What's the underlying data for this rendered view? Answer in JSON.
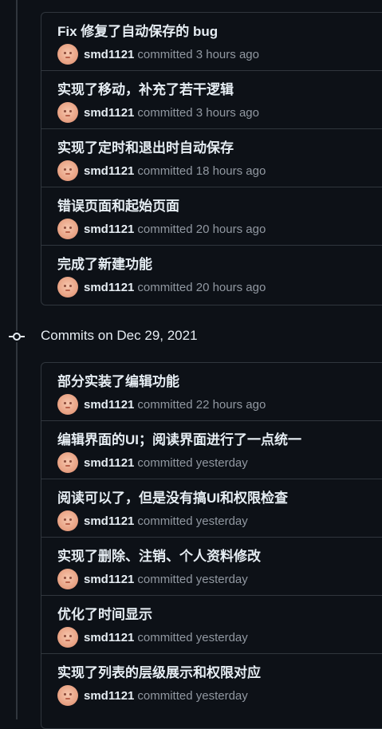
{
  "groups": [
    {
      "header": "",
      "commits": [
        {
          "title": "Fix 修复了自动保存的 bug",
          "author": "smd1121",
          "meta": "committed 3 hours ago"
        },
        {
          "title": "实现了移动，补充了若干逻辑",
          "author": "smd1121",
          "meta": "committed 3 hours ago"
        },
        {
          "title": "实现了定时和退出时自动保存",
          "author": "smd1121",
          "meta": "committed 18 hours ago"
        },
        {
          "title": "错误页面和起始页面",
          "author": "smd1121",
          "meta": "committed 20 hours ago"
        },
        {
          "title": "完成了新建功能",
          "author": "smd1121",
          "meta": "committed 20 hours ago"
        }
      ]
    },
    {
      "header": "Commits on Dec 29, 2021",
      "commits": [
        {
          "title": "部分实装了编辑功能",
          "author": "smd1121",
          "meta": "committed 22 hours ago"
        },
        {
          "title": "编辑界面的UI；阅读界面进行了一点统一",
          "author": "smd1121",
          "meta": "committed yesterday"
        },
        {
          "title": "阅读可以了，但是没有搞UI和权限检查",
          "author": "smd1121",
          "meta": "committed yesterday"
        },
        {
          "title": "实现了删除、注销、个人资料修改",
          "author": "smd1121",
          "meta": "committed yesterday"
        },
        {
          "title": "优化了时间显示",
          "author": "smd1121",
          "meta": "committed yesterday"
        },
        {
          "title": "实现了列表的层级展示和权限对应",
          "author": "smd1121",
          "meta": "committed yesterday"
        }
      ]
    }
  ],
  "icons": {
    "commit_node": "git-commit-icon",
    "avatar": "user-avatar"
  },
  "colors": {
    "background": "#0d1117",
    "border": "#30363d",
    "text": "#e6edf3",
    "muted": "#9198a1"
  }
}
